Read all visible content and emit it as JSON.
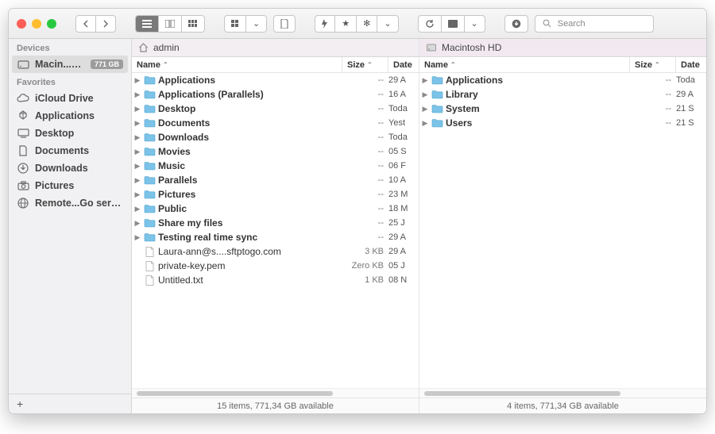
{
  "toolbar": {
    "search_placeholder": "Search"
  },
  "sidebar": {
    "sections": [
      {
        "label": "Devices",
        "items": [
          {
            "label": "Macin...sh HD",
            "icon": "hdd",
            "badge": "771 GB",
            "selected": true
          }
        ]
      },
      {
        "label": "Favorites",
        "items": [
          {
            "label": "iCloud Drive",
            "icon": "cloud"
          },
          {
            "label": "Applications",
            "icon": "apps"
          },
          {
            "label": "Desktop",
            "icon": "desktop"
          },
          {
            "label": "Documents",
            "icon": "doc"
          },
          {
            "label": "Downloads",
            "icon": "download"
          },
          {
            "label": "Pictures",
            "icon": "camera"
          },
          {
            "label": "Remote...Go server",
            "icon": "share"
          }
        ]
      }
    ]
  },
  "panes": [
    {
      "title": "admin",
      "title_icon": "home",
      "columns": [
        "Name",
        "Size",
        "Date"
      ],
      "items": [
        {
          "name": "Applications",
          "type": "folder",
          "size": "--",
          "date": "29 A"
        },
        {
          "name": "Applications (Parallels)",
          "type": "folder",
          "size": "--",
          "date": "16 A"
        },
        {
          "name": "Desktop",
          "type": "folder",
          "size": "--",
          "date": "Toda"
        },
        {
          "name": "Documents",
          "type": "folder",
          "size": "--",
          "date": "Yest"
        },
        {
          "name": "Downloads",
          "type": "folder",
          "size": "--",
          "date": "Toda"
        },
        {
          "name": "Movies",
          "type": "folder",
          "size": "--",
          "date": "05 S"
        },
        {
          "name": "Music",
          "type": "folder",
          "size": "--",
          "date": "06 F"
        },
        {
          "name": "Parallels",
          "type": "folder",
          "size": "--",
          "date": "10 A"
        },
        {
          "name": "Pictures",
          "type": "folder",
          "size": "--",
          "date": "23 M"
        },
        {
          "name": "Public",
          "type": "folder",
          "size": "--",
          "date": "18 M"
        },
        {
          "name": "Share my files",
          "type": "folder",
          "size": "--",
          "date": "25 J"
        },
        {
          "name": "Testing real time sync",
          "type": "folder",
          "size": "--",
          "date": "29 A"
        },
        {
          "name": "Laura-ann@s....sftptogo.com",
          "type": "file",
          "size": "3 KB",
          "date": "29 A"
        },
        {
          "name": "private-key.pem",
          "type": "file",
          "size": "Zero KB",
          "date": "05 J"
        },
        {
          "name": "Untitled.txt",
          "type": "file",
          "size": "1 KB",
          "date": "08 N"
        }
      ],
      "status": "15 items, 771,34 GB available"
    },
    {
      "title": "Macintosh HD",
      "title_icon": "hdd",
      "columns": [
        "Name",
        "Size",
        "Date"
      ],
      "items": [
        {
          "name": "Applications",
          "type": "folder",
          "size": "--",
          "date": "Toda"
        },
        {
          "name": "Library",
          "type": "folder",
          "size": "--",
          "date": "29 A"
        },
        {
          "name": "System",
          "type": "folder",
          "size": "--",
          "date": "21 S"
        },
        {
          "name": "Users",
          "type": "folder",
          "size": "--",
          "date": "21 S"
        }
      ],
      "status": "4 items, 771,34 GB available"
    }
  ]
}
